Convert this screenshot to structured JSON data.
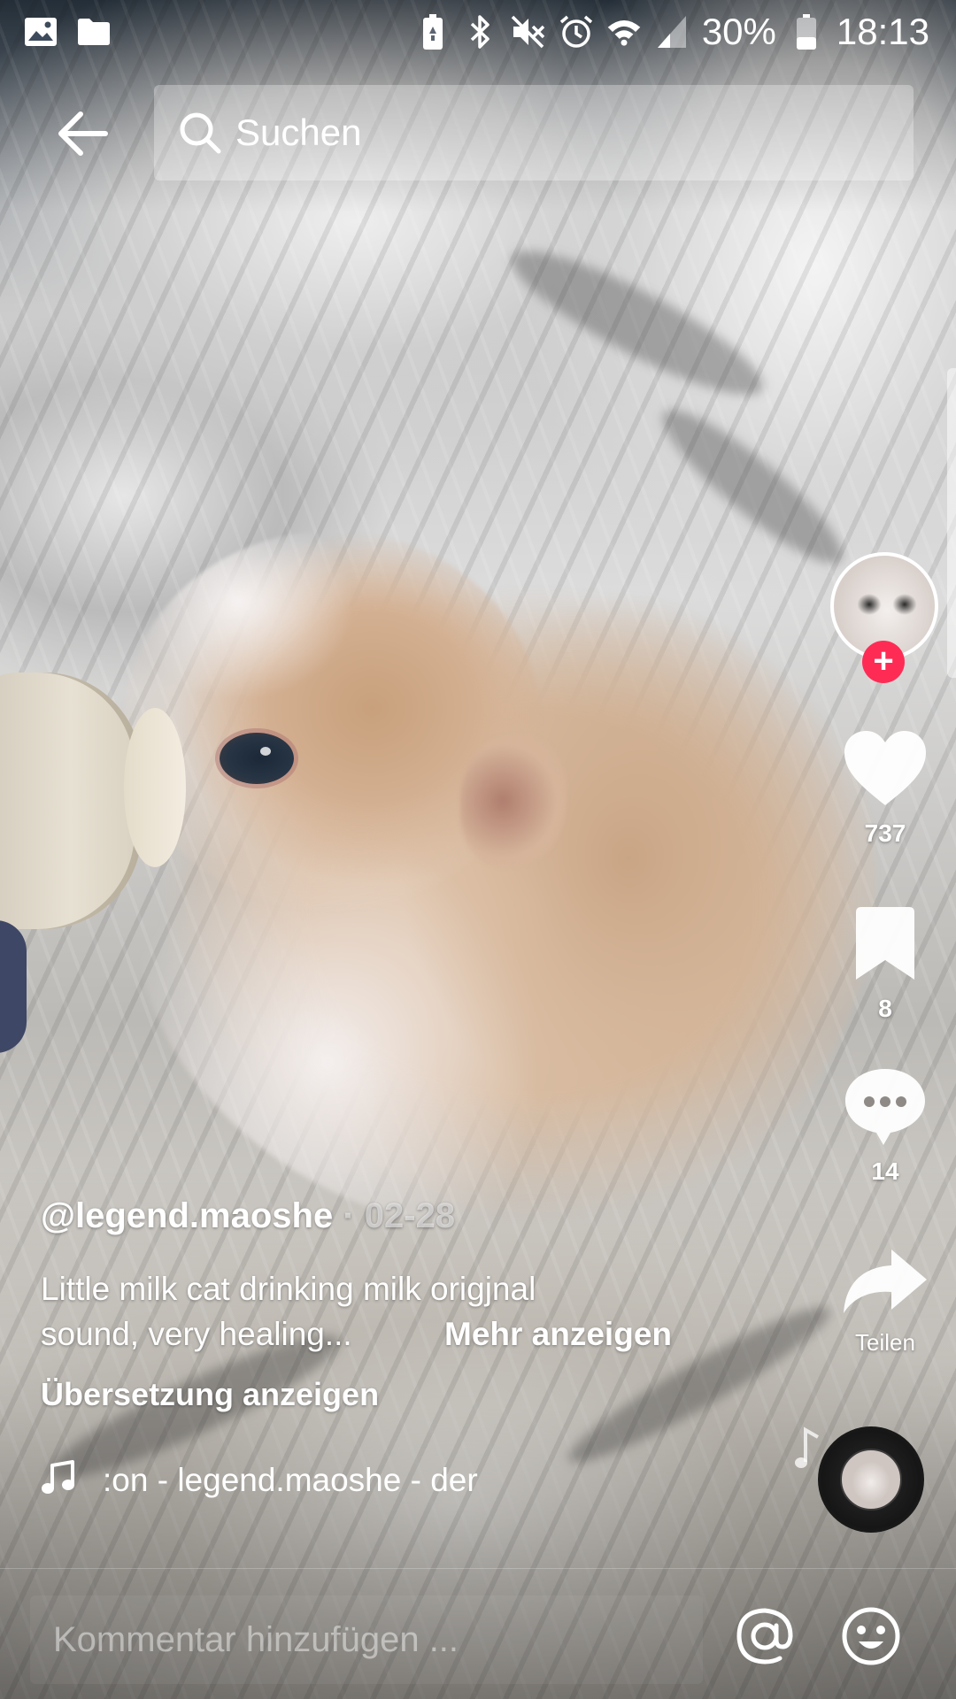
{
  "status_bar": {
    "battery_percent": "30%",
    "time": "18:13",
    "icons": [
      "image-icon",
      "folder-icon",
      "battery-saver-icon",
      "bluetooth-icon",
      "mute-icon",
      "alarm-icon",
      "wifi-icon",
      "signal-icon",
      "battery-icon"
    ]
  },
  "search": {
    "placeholder": "Suchen"
  },
  "video": {
    "author": "@legend.maoshe",
    "date_separator": " · ",
    "date": "02-28",
    "description_line1": "Little milk cat drinking milk origjnal",
    "description_line2": "sound, very healing...",
    "more_label": "Mehr anzeigen",
    "translate_label": "Übersetzung anzeigen",
    "sound_text": ":on - legend.maoshe - der"
  },
  "actions": {
    "likes": "737",
    "bookmarks": "8",
    "comments": "14",
    "share_label": "Teilen",
    "follow_symbol": "+"
  },
  "comment_bar": {
    "placeholder": "Kommentar hinzufügen ..."
  },
  "colors": {
    "accent": "#fe2c55",
    "text": "#ffffff"
  }
}
